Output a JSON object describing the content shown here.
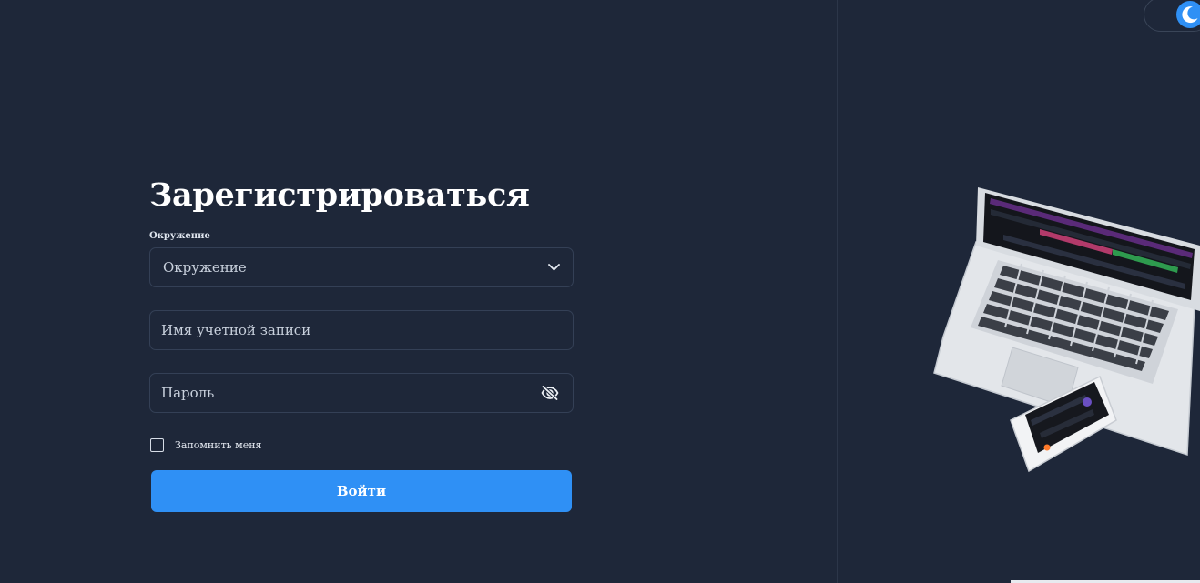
{
  "form": {
    "title": "Зарегистрироваться",
    "environment_label": "Окружение",
    "environment_select_value": "Окружение",
    "username_placeholder": "Имя учетной записи",
    "password_placeholder": "Пароль",
    "remember_label": "Запомнить меня",
    "login_button_label": "Войти"
  },
  "icons": {
    "select_chevron": "chevron-down-icon",
    "password_visibility": "eye-slash-icon",
    "theme_toggle": "moon-icon"
  },
  "colors": {
    "background": "#1e2739",
    "accent": "#2f90f5",
    "field_border": "#344056"
  }
}
